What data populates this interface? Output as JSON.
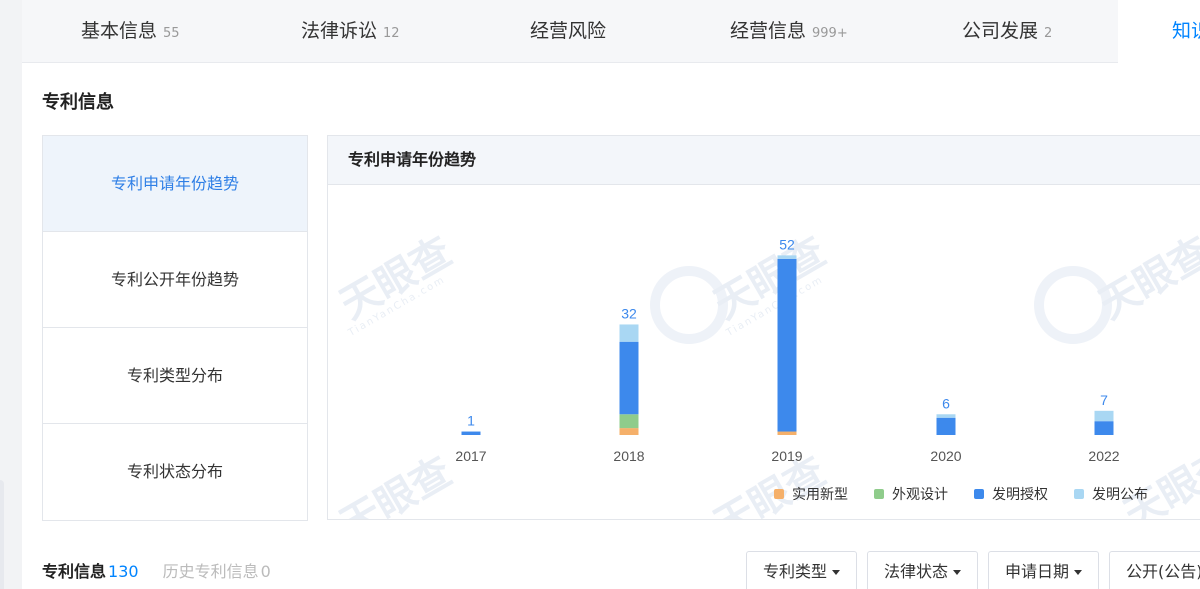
{
  "tabs": [
    {
      "label": "基本信息",
      "count": "55"
    },
    {
      "label": "法律诉讼",
      "count": "12"
    },
    {
      "label": "经营风险",
      "count": ""
    },
    {
      "label": "经营信息",
      "count": "999+"
    },
    {
      "label": "公司发展",
      "count": "2"
    },
    {
      "label": "知识",
      "count": ""
    }
  ],
  "section_title": "专利信息",
  "side_menu": [
    {
      "label": "专利申请年份趋势"
    },
    {
      "label": "专利公开年份趋势"
    },
    {
      "label": "专利类型分布"
    },
    {
      "label": "专利状态分布"
    }
  ],
  "chart_panel": {
    "title": "专利申请年份趋势"
  },
  "watermark": {
    "brand": "天眼查",
    "url": "TianYanCha.com"
  },
  "chart_data": {
    "type": "bar",
    "stacked": true,
    "title": "",
    "xlabel": "",
    "ylabel": "",
    "categories": [
      "2017",
      "2018",
      "2019",
      "2020",
      "2022"
    ],
    "totals": [
      1,
      32,
      52,
      6,
      7
    ],
    "series": [
      {
        "name": "实用新型",
        "color": "#f5b06a",
        "values": [
          0,
          2,
          1,
          0,
          0
        ]
      },
      {
        "name": "外观设计",
        "color": "#8fcc8b",
        "values": [
          0,
          4,
          0,
          0,
          0
        ]
      },
      {
        "name": "发明授权",
        "color": "#3d89ec",
        "values": [
          1,
          21,
          50,
          5,
          4
        ]
      },
      {
        "name": "发明公布",
        "color": "#a9d7f3",
        "values": [
          0,
          5,
          1,
          1,
          3
        ]
      }
    ],
    "ylim": [
      0,
      55
    ],
    "grid": false,
    "legend_position": "bottom-right"
  },
  "bottom_tabs": [
    {
      "label": "专利信息",
      "count": "130"
    },
    {
      "label": "历史专利信息",
      "count": "0"
    }
  ],
  "filters": [
    {
      "label": "专利类型"
    },
    {
      "label": "法律状态"
    },
    {
      "label": "申请日期"
    },
    {
      "label": "公开(公告)"
    }
  ]
}
